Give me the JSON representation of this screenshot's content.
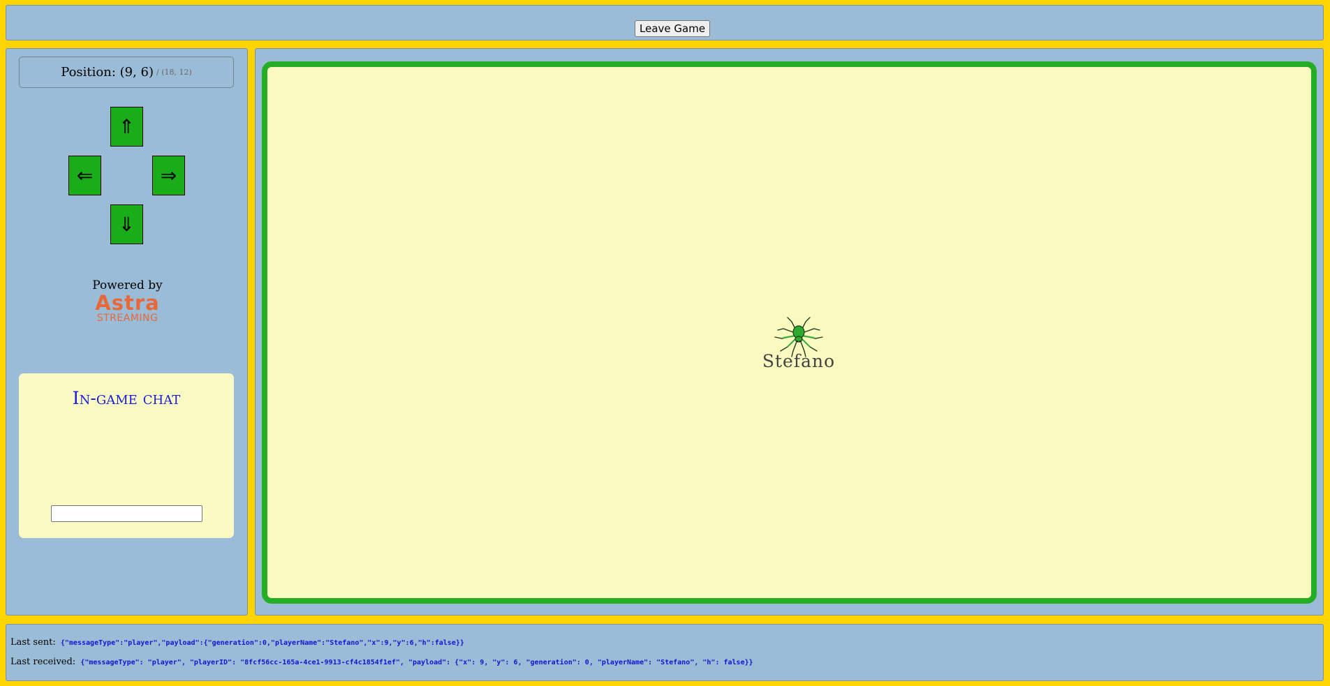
{
  "header": {
    "leave_label": "Leave Game"
  },
  "position": {
    "label": "Position: (9, 6)",
    "max_label": "/ (18, 12)"
  },
  "controls": {
    "up": "⇑",
    "left": "⇐",
    "right": "⇒",
    "down": "⇓"
  },
  "branding": {
    "powered_by": "Powered by",
    "logo_word": "Astra",
    "logo_sub": "STREAMING"
  },
  "chat": {
    "title": "In-game chat",
    "input_value": ""
  },
  "board": {
    "player_name": "Stefano",
    "player_icon": "spider-icon",
    "border_color": "#26ad26",
    "background_color": "#fafac0"
  },
  "status": {
    "sent_label": "Last sent:",
    "sent_message": "{\"messageType\":\"player\",\"payload\":{\"generation\":0,\"playerName\":\"Stefano\",\"x\":9,\"y\":6,\"h\":false}}",
    "received_label": "Last received:",
    "received_message": "{\"messageType\": \"player\", \"playerID\": \"8fcf56cc-165a-4ce1-9913-cf4c1854f1ef\", \"payload\": {\"x\": 9, \"y\": 6, \"generation\": 0, \"playerName\": \"Stefano\", \"h\": false}}"
  },
  "colors": {
    "page_background": "#ffd400",
    "panel_background": "#9bbcd6",
    "arrow_button": "#1aad1a",
    "chat_title": "#1c1cd8",
    "logo": "#e8683a",
    "message_text": "#1414d0"
  }
}
